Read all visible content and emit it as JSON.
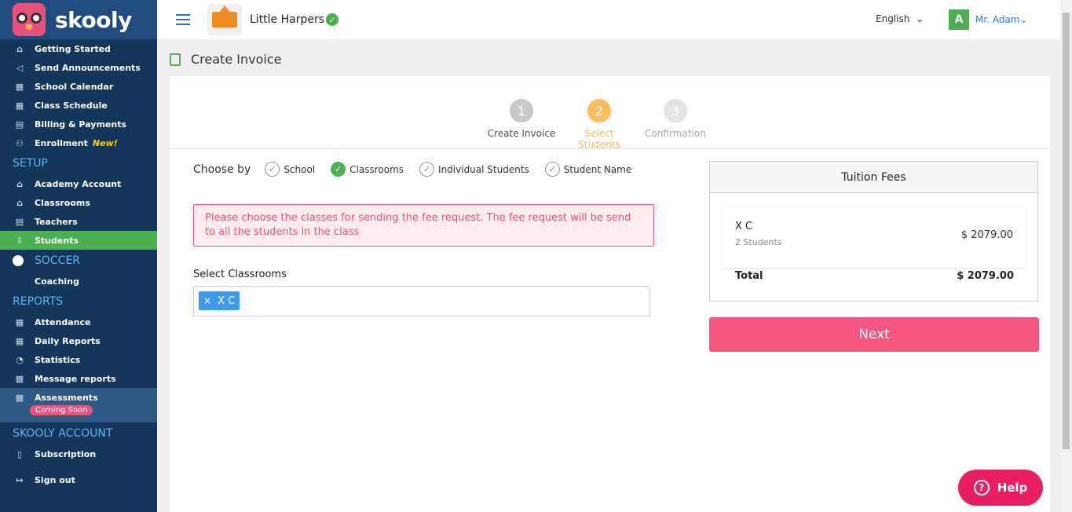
{
  "app": {
    "logo_text": "skooly"
  },
  "sidebar": {
    "main": [
      {
        "label": "Getting Started",
        "icon": "⌂"
      },
      {
        "label": "Send Announcements",
        "icon": "📣"
      },
      {
        "label": "School Calendar",
        "icon": "▦"
      },
      {
        "label": "Class Schedule",
        "icon": "▦"
      },
      {
        "label": "Billing & Payments",
        "icon": "▤"
      },
      {
        "label": "Enrollment",
        "icon": "⚇",
        "badge": "New!"
      }
    ],
    "setup_title": "SETUP",
    "setup": [
      {
        "label": "Academy Account",
        "icon": "⌂"
      },
      {
        "label": "Classrooms",
        "icon": "⌂"
      },
      {
        "label": "Teachers",
        "icon": "▤"
      },
      {
        "label": "Students",
        "icon": "⇩"
      }
    ],
    "soccer_title": "SOCCER",
    "soccer": [
      {
        "label": "Coaching",
        "icon": "⚑"
      }
    ],
    "reports_title": "REPORTS",
    "reports": [
      {
        "label": "Attendance",
        "icon": "▦"
      },
      {
        "label": "Daily Reports",
        "icon": "▦"
      },
      {
        "label": "Statistics",
        "icon": "◔"
      },
      {
        "label": "Message reports",
        "icon": "▦"
      },
      {
        "label": "Assessments",
        "icon": "▦",
        "badge": "Coming Soon"
      }
    ],
    "account_title": "SKOOLY ACCOUNT",
    "account": [
      {
        "label": "Subscription",
        "icon": "▯"
      },
      {
        "label": "Sign out",
        "icon": "↦"
      }
    ]
  },
  "topbar": {
    "school_name": "Little Harpers",
    "verified": "✓",
    "language": "English",
    "avatar": "A",
    "user": "Mr. Adam"
  },
  "page": {
    "title": "Create Invoice"
  },
  "steps": [
    {
      "num": "1",
      "label": "Create Invoice"
    },
    {
      "num": "2",
      "label": "Select Students"
    },
    {
      "num": "3",
      "label": "Confirmation"
    }
  ],
  "choose": {
    "label": "Choose by",
    "options": [
      {
        "label": "School",
        "selected": false
      },
      {
        "label": "Classrooms",
        "selected": true
      },
      {
        "label": "Individual Students",
        "selected": false
      },
      {
        "label": "Student Name",
        "selected": false
      }
    ]
  },
  "alert": {
    "text": "Please choose the classes for sending the fee request. The fee request will be send to all the students in the class"
  },
  "classrooms": {
    "label": "Select Classrooms",
    "tag": "X C",
    "remove": "×"
  },
  "fees": {
    "title": "Tuition Fees",
    "item_name": "X C",
    "item_sub": "2 Students",
    "item_amount": "$ 2079.00",
    "total_label": "Total",
    "total_amount": "$ 2079.00"
  },
  "actions": {
    "next": "Next"
  },
  "help": {
    "label": "Help",
    "icon": "?"
  },
  "colors": {
    "sidebar": "#14365a",
    "active": "#4caf50",
    "accent": "#f5567f",
    "step_active": "#fbbc5c",
    "link": "#2a7ad4"
  }
}
